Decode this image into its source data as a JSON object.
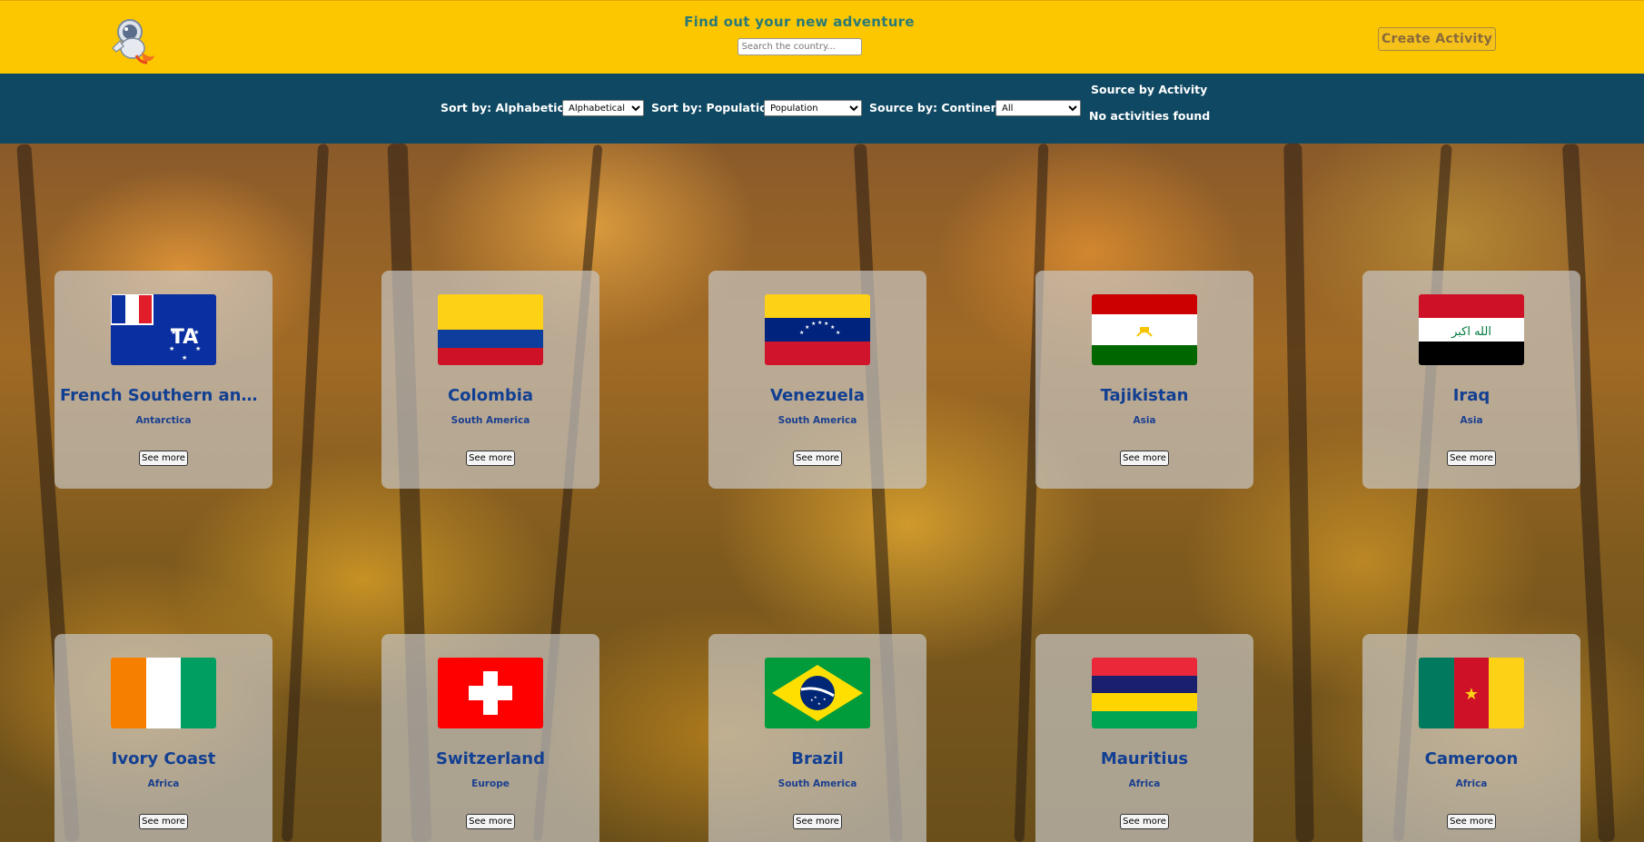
{
  "header": {
    "title": "Find out your new adventure",
    "search_placeholder": "Search the country...",
    "create_button": "Create Activity",
    "background_color": "#fdc700"
  },
  "filters": {
    "alpha_label": "Sort by: Alphabetical",
    "alpha_value": "Alphabetical",
    "population_label": "Sort by: Population",
    "population_value": "Population",
    "continent_label": "Source by: Continents",
    "continent_value": "All",
    "activity_label": "Source by Activity",
    "activity_status": "No activities found",
    "background_color": "#0e4862"
  },
  "card_action_label": "See more",
  "countries": [
    {
      "name": "French Southern and Antarctic Lands",
      "continent": "Antarctica",
      "flag": "atf"
    },
    {
      "name": "Colombia",
      "continent": "South America",
      "flag": "col"
    },
    {
      "name": "Venezuela",
      "continent": "South America",
      "flag": "ven"
    },
    {
      "name": "Tajikistan",
      "continent": "Asia",
      "flag": "tjk"
    },
    {
      "name": "Iraq",
      "continent": "Asia",
      "flag": "irq"
    },
    {
      "name": "Ivory Coast",
      "continent": "Africa",
      "flag": "civ"
    },
    {
      "name": "Switzerland",
      "continent": "Europe",
      "flag": "che"
    },
    {
      "name": "Brazil",
      "continent": "South America",
      "flag": "bra"
    },
    {
      "name": "Mauritius",
      "continent": "Africa",
      "flag": "mus"
    },
    {
      "name": "Cameroon",
      "continent": "Africa",
      "flag": "cmr"
    }
  ]
}
